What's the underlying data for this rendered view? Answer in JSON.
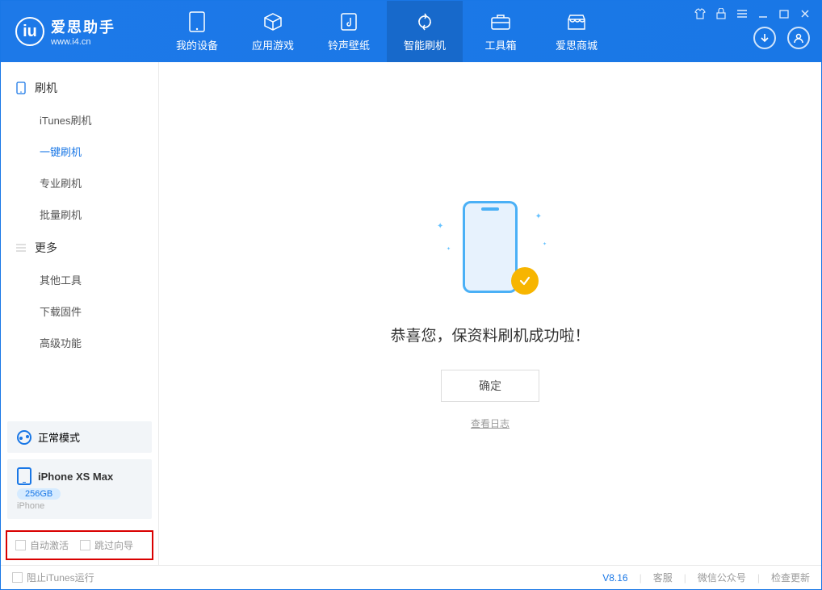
{
  "app": {
    "title": "爱思助手",
    "subtitle": "www.i4.cn",
    "logo_letter": "iu"
  },
  "nav": {
    "tabs": [
      {
        "label": "我的设备",
        "icon": "device-icon"
      },
      {
        "label": "应用游戏",
        "icon": "cube-icon"
      },
      {
        "label": "铃声壁纸",
        "icon": "music-icon"
      },
      {
        "label": "智能刷机",
        "icon": "refresh-icon",
        "active": true
      },
      {
        "label": "工具箱",
        "icon": "toolbox-icon"
      },
      {
        "label": "爱思商城",
        "icon": "store-icon"
      }
    ]
  },
  "sidebar": {
    "group1": {
      "title": "刷机",
      "items": [
        "iTunes刷机",
        "一键刷机",
        "专业刷机",
        "批量刷机"
      ],
      "active_index": 1
    },
    "group2": {
      "title": "更多",
      "items": [
        "其他工具",
        "下载固件",
        "高级功能"
      ]
    },
    "mode_card": {
      "label": "正常模式"
    },
    "device_card": {
      "name": "iPhone XS Max",
      "storage": "256GB",
      "type": "iPhone"
    },
    "options": {
      "auto_activate": "自动激活",
      "skip_guide": "跳过向导"
    }
  },
  "main": {
    "success_message": "恭喜您，保资料刷机成功啦！",
    "ok_button": "确定",
    "view_log": "查看日志"
  },
  "statusbar": {
    "block_itunes": "阻止iTunes运行",
    "version": "V8.16",
    "links": [
      "客服",
      "微信公众号",
      "检查更新"
    ]
  }
}
